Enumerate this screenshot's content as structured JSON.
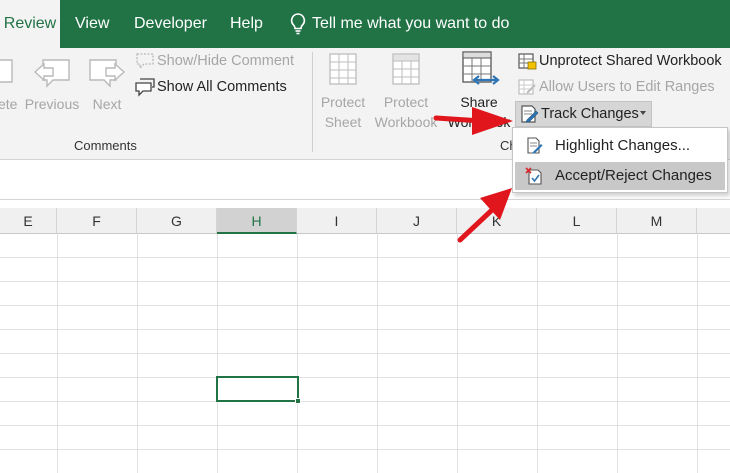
{
  "tabs": [
    {
      "label": "Review",
      "active": true
    },
    {
      "label": "View"
    },
    {
      "label": "Developer"
    },
    {
      "label": "Help"
    }
  ],
  "tell_me": "Tell me what you want to do",
  "comments_group": {
    "delete_partial": "ete",
    "previous": "Previous",
    "next": "Next",
    "show_hide": "Show/Hide Comment",
    "show_all": "Show All Comments",
    "label": "Comments"
  },
  "protect_group": {
    "protect_sheet_1": "Protect",
    "protect_sheet_2": "Sheet",
    "protect_workbook_1": "Protect",
    "protect_workbook_2": "Workbook",
    "share_1": "Share",
    "share_2": "Workbook",
    "unprotect_shared": "Unprotect Shared Workbook",
    "allow_users": "Allow Users to Edit Ranges",
    "track_changes": "Track Changes",
    "label_partial": "Ch"
  },
  "menu": {
    "highlight": "Highlight Changes...",
    "accept_reject": "Accept/Reject Changes"
  },
  "columns": [
    "E",
    "F",
    "G",
    "H",
    "I",
    "J",
    "K",
    "L",
    "M"
  ],
  "selected_column": "H",
  "colors": {
    "excel_green": "#217346",
    "arrow_red": "#e0161c"
  }
}
